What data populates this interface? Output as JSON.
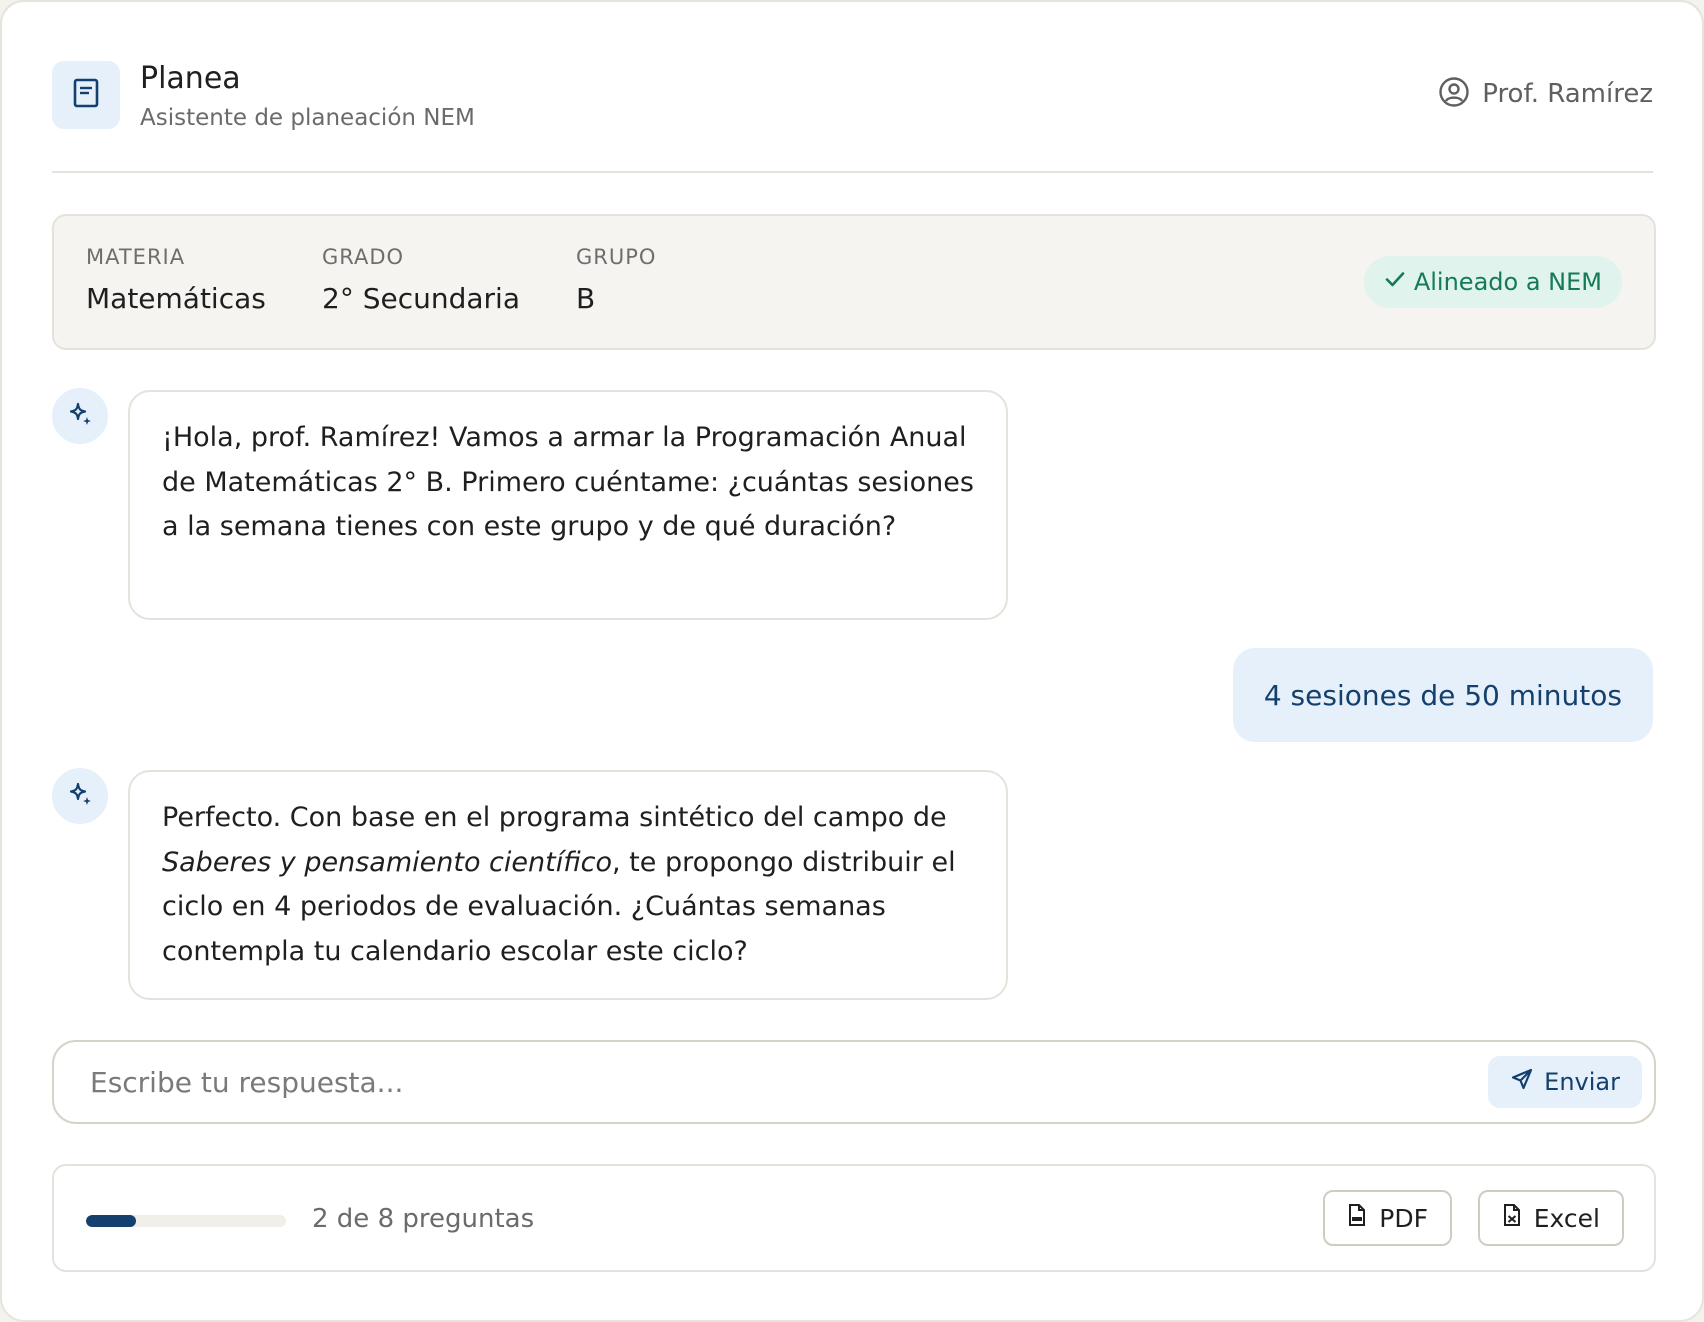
{
  "header": {
    "app_title": "Planea",
    "app_subtitle": "Asistente de planeación NEM",
    "user_name": "Prof. Ramírez"
  },
  "context": {
    "fields": [
      {
        "label": "MATERIA",
        "value": "Matemáticas"
      },
      {
        "label": "GRADO",
        "value": "2° Secundaria"
      },
      {
        "label": "GRUPO",
        "value": "B"
      }
    ],
    "badge": "Alineado a NEM"
  },
  "messages": {
    "bot_1": "¡Hola, prof. Ramírez! Vamos a armar la Programación Anual de Matemáticas 2° B. Primero cuéntame: ¿cuántas sesiones a la semana tienes con este grupo y de qué duración?",
    "user_1": "4 sesiones de 50 minutos",
    "bot_2": {
      "before": "Perfecto. Con base en el programa sintético del campo de ",
      "emphasis": "Saberes y pensamiento científico",
      "after": ", te propongo distribuir el ciclo en 4 periodos de evaluación. ¿Cuántas semanas contempla tu calendario escolar este ciclo?"
    }
  },
  "composer": {
    "placeholder": "Escribe tu respuesta...",
    "value": "",
    "send_label": "Enviar"
  },
  "footer": {
    "progress_text": "2 de 8 preguntas",
    "progress_fraction": 0.25,
    "pdf_label": "PDF",
    "excel_label": "Excel"
  },
  "colors": {
    "accent": "#14406e",
    "accent_soft": "#e6f0fa",
    "success": "#157a5a",
    "success_soft": "#e0f3ec"
  },
  "icons": {
    "logo": "notebook-icon",
    "user": "user-circle-icon",
    "bot": "sparkle-icon",
    "badge": "check-icon",
    "send": "send-icon",
    "pdf": "pdf-file-icon",
    "excel": "xls-file-icon"
  }
}
